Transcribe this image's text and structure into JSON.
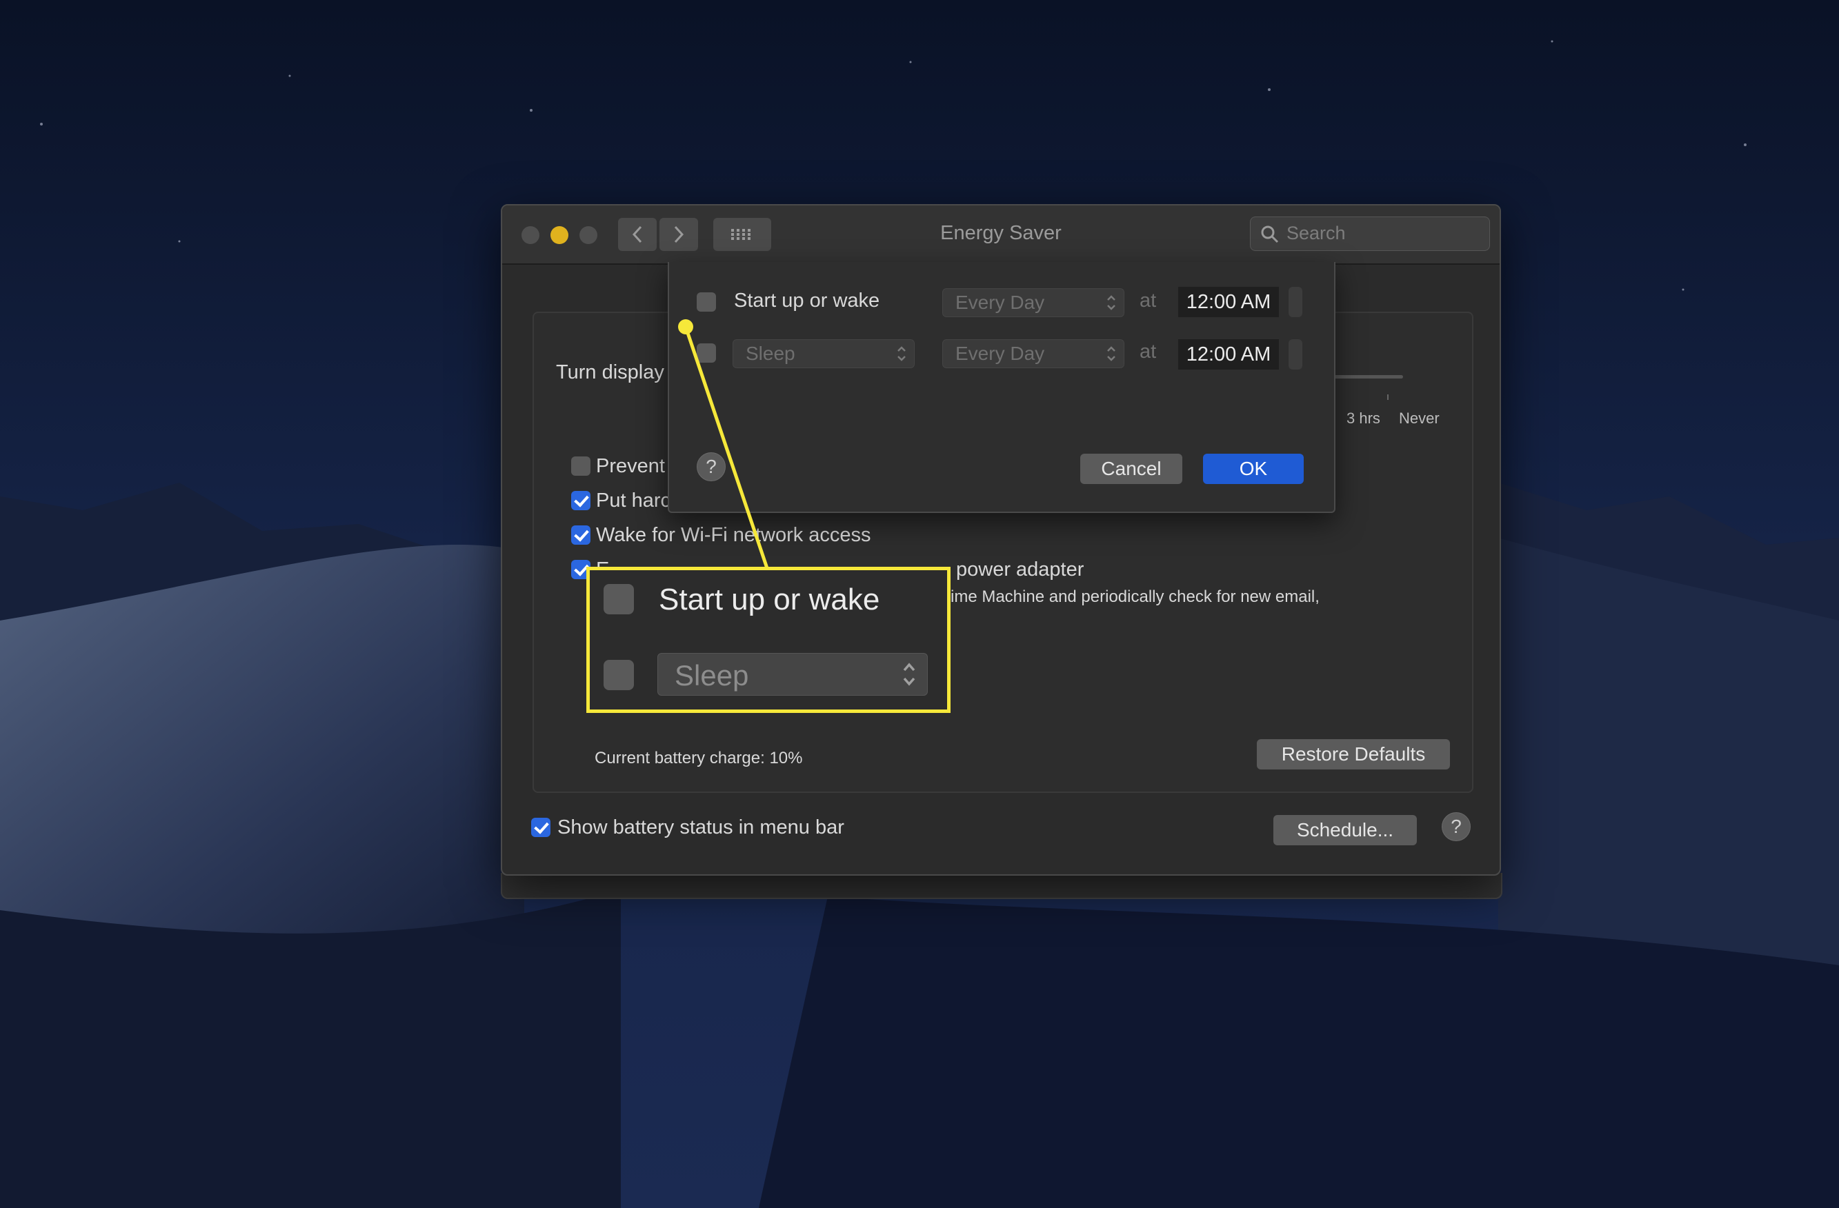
{
  "window": {
    "title": "Energy Saver",
    "search_placeholder": "Search"
  },
  "main": {
    "turn_display_label": "Turn display",
    "slider_labels": [
      "3 hrs",
      "Never"
    ],
    "checkboxes": [
      {
        "label": "Prevent",
        "checked": false
      },
      {
        "label": "Put harc",
        "checked": true
      },
      {
        "label": "Wake for Wi-Fi network access",
        "checked": true
      },
      {
        "label": "E",
        "checked": true
      }
    ],
    "power_adapter_text": "power adapter",
    "description_text": "ime Machine and periodically check for new email,",
    "battery_text": "Current battery charge: 10%",
    "restore_defaults_label": "Restore Defaults",
    "show_battery_label": "Show battery status in menu bar",
    "show_battery_checked": true,
    "schedule_label": "Schedule...",
    "help_label": "?"
  },
  "schedule_sheet": {
    "row1": {
      "label": "Start up or wake",
      "checked": false,
      "frequency": "Every Day",
      "at": "at",
      "time": "12:00 AM"
    },
    "row2": {
      "action": "Sleep",
      "checked": false,
      "frequency": "Every Day",
      "at": "at",
      "time": "12:00 AM"
    },
    "help_label": "?",
    "cancel_label": "Cancel",
    "ok_label": "OK"
  },
  "callout": {
    "start_label": "Start up or wake",
    "sleep_label": "Sleep"
  },
  "colors": {
    "accent": "#2b67e0",
    "highlight": "#f6e83a",
    "window_bg": "#2b2b2b"
  }
}
